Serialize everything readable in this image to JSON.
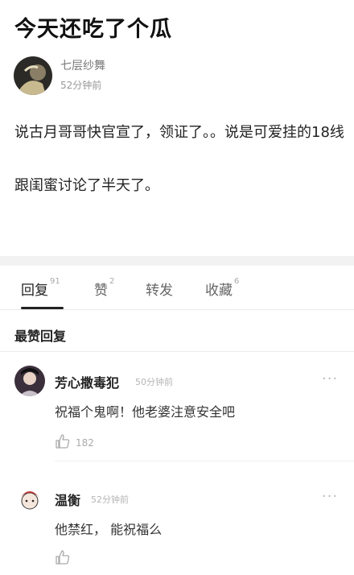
{
  "post": {
    "title": "今天还吃了个瓜",
    "author_name": "七层纱舞",
    "author_time": "52分钟前",
    "body_lines": [
      "说古月哥哥快官宣了，领证了。。说是可爱挂的18线",
      "跟闺蜜讨论了半天了。"
    ]
  },
  "tabs": [
    {
      "label": "回复",
      "count": "91"
    },
    {
      "label": "赞",
      "count": "2"
    },
    {
      "label": "转发",
      "count": ""
    },
    {
      "label": "收藏",
      "count": "6"
    }
  ],
  "section_heading": "最赞回复",
  "comments": [
    {
      "name": "芳心撒毒犯",
      "time": "50分钟前",
      "text": "祝福个鬼啊！他老婆注意安全吧",
      "likes": "182",
      "more": "···"
    },
    {
      "name": "温衡",
      "time": "52分钟前",
      "text": "他禁红， 能祝福么",
      "likes": "",
      "more": "···"
    }
  ],
  "colors": {
    "accent": "#222222",
    "muted": "#999999",
    "divider": "#f2f2f2"
  },
  "icons": {
    "like": "thumbs-up-icon",
    "more": "more-dots-icon"
  }
}
